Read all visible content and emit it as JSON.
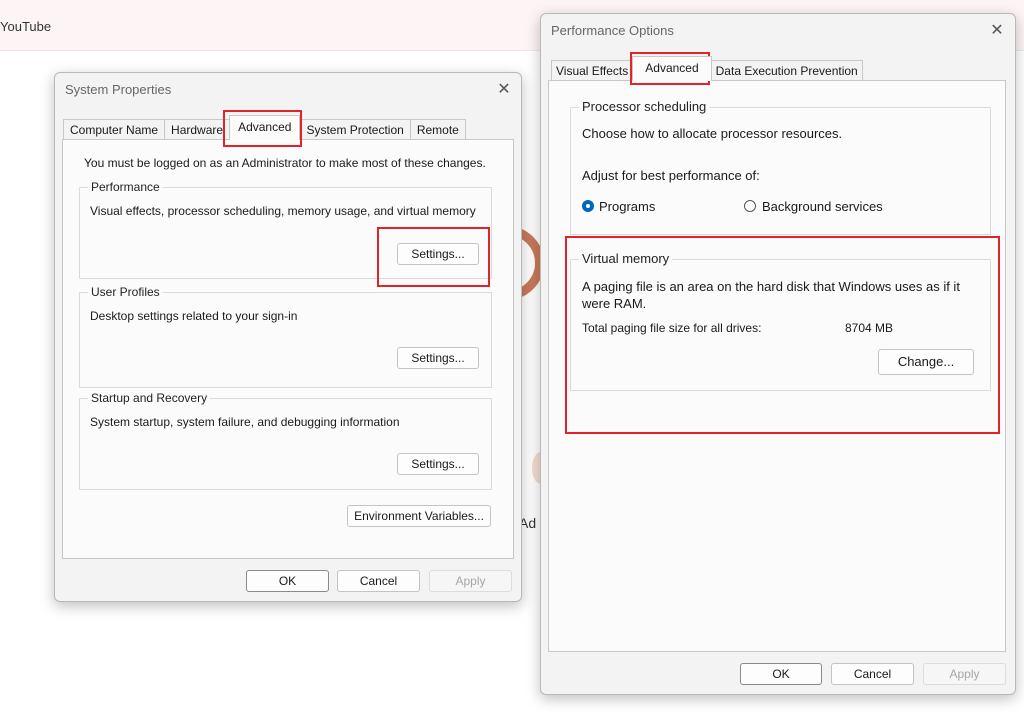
{
  "browser": {
    "tab_label": "YouTube",
    "bg_text": "Ad"
  },
  "system_properties": {
    "title": "System Properties",
    "close_glyph": "✕",
    "tabs": [
      {
        "label": "Computer Name"
      },
      {
        "label": "Hardware"
      },
      {
        "label": "Advanced",
        "active": true
      },
      {
        "label": "System Protection"
      },
      {
        "label": "Remote"
      }
    ],
    "admin_note": "You must be logged on as an Administrator to make most of these changes.",
    "performance": {
      "legend": "Performance",
      "description": "Visual effects, processor scheduling, memory usage, and virtual memory",
      "button": "Settings..."
    },
    "user_profiles": {
      "legend": "User Profiles",
      "description": "Desktop settings related to your sign-in",
      "button": "Settings..."
    },
    "startup_recovery": {
      "legend": "Startup and Recovery",
      "description": "System startup, system failure, and debugging information",
      "button": "Settings..."
    },
    "env_button": "Environment Variables...",
    "ok": "OK",
    "cancel": "Cancel",
    "apply": "Apply"
  },
  "performance_options": {
    "title": "Performance Options",
    "close_glyph": "✕",
    "tabs": [
      {
        "label": "Visual Effects"
      },
      {
        "label": "Advanced",
        "active": true
      },
      {
        "label": "Data Execution Prevention"
      }
    ],
    "processor_scheduling": {
      "legend": "Processor scheduling",
      "line1": "Choose how to allocate processor resources.",
      "line2": "Adjust for best performance of:",
      "option_programs": "Programs",
      "option_background": "Background services",
      "selected": "Programs"
    },
    "virtual_memory": {
      "legend": "Virtual memory",
      "line1": "A paging file is an area on the hard disk that Windows uses as if it",
      "line2": "were RAM.",
      "total_label": "Total paging file size for all drives:",
      "total_value": "8704 MB",
      "change_button": "Change..."
    },
    "ok": "OK",
    "cancel": "Cancel",
    "apply": "Apply"
  },
  "colors": {
    "highlight": "#e1242a",
    "radio_selected": "#0067c0"
  }
}
